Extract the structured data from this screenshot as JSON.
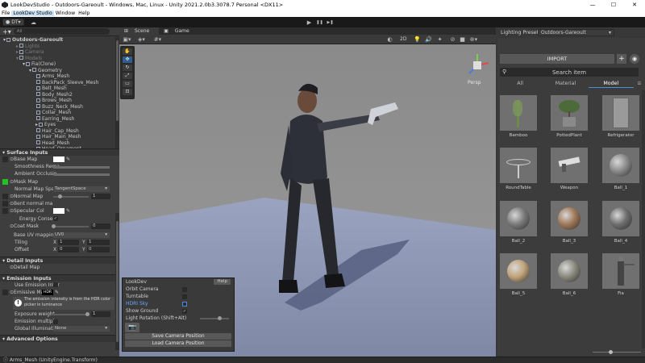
{
  "window": {
    "title": "LookDevStudio - Outdoors-Gareoult - Windows, Mac, Linux - Unity 2021.2.0b3.3078.7 Personal <DX11>",
    "min": "—",
    "max": "☐",
    "close": "✕"
  },
  "menu": [
    "File",
    "LookDev Studio",
    "Window",
    "Help"
  ],
  "toolbar": {
    "account": "DT",
    "play": "▶",
    "pause": "❚❚",
    "step": "▶❚"
  },
  "hierarchy": {
    "search_placeholder": "All",
    "items": [
      {
        "label": "Outdoors-Gareoult",
        "indent": 0,
        "bold": true
      },
      {
        "label": "Lights",
        "indent": 2,
        "dim": true
      },
      {
        "label": "Camera",
        "indent": 2,
        "dim": true
      },
      {
        "label": "Models",
        "indent": 2,
        "dim": true
      },
      {
        "label": "Fia(Clone)",
        "indent": 3
      },
      {
        "label": "Geometry",
        "indent": 4
      },
      {
        "label": "Arms_Mesh",
        "indent": 5
      },
      {
        "label": "BackPack_Sleeve_Mesh",
        "indent": 5
      },
      {
        "label": "Belt_Mesh",
        "indent": 5
      },
      {
        "label": "Body_Mesh2",
        "indent": 5
      },
      {
        "label": "Brows_Mesh",
        "indent": 5
      },
      {
        "label": "Buzz_Neck_Mesh",
        "indent": 5
      },
      {
        "label": "Collar_Mesh",
        "indent": 5
      },
      {
        "label": "Earring_Mesh",
        "indent": 5
      },
      {
        "label": "Eyes",
        "indent": 5
      },
      {
        "label": "Hair_Cap_Mesh",
        "indent": 5
      },
      {
        "label": "Hair_Main_Mesh",
        "indent": 5
      },
      {
        "label": "Head_Mesh",
        "indent": 5
      },
      {
        "label": "Head_Ornament",
        "indent": 5
      }
    ]
  },
  "inspector": {
    "surface_inputs": "Surface Inputs",
    "base_map": "Base Map",
    "smoothness": "Smoothness Rema",
    "ambient_occlusion": "Ambient Occlusio",
    "mask_map": "Mask Map",
    "normal_map_space": "Normal Map Spac",
    "normal_map_space_value": "TangentSpace",
    "normal_map": "Normal Map",
    "normal_map_value": "1",
    "bent_normal": "Bent normal ma",
    "specular": "Specular Col",
    "energy": "Energy Conserv",
    "coat_mask": "Coat Mask",
    "coat_mask_value": "0",
    "base_uv_mapping": "Base UV mapping",
    "base_uv_value": "UV0",
    "tiling": "Tiling",
    "offset": "Offset",
    "tiling_x": "1",
    "tiling_y": "1",
    "offset_x": "0",
    "offset_y": "0",
    "x_label": "X",
    "y_label": "Y",
    "detail_inputs": "Detail Inputs",
    "detail_map": "Detail Map",
    "emission_inputs": "Emission Inputs",
    "use_emission": "Use Emission Inter",
    "emissive_map": "Emissive Ma",
    "hdr_badge": "HDR",
    "help_text": "The emission intensity is from the HDR color picker in luminance",
    "exposure_weight": "Exposure weight",
    "exposure_value": "1",
    "emission_multiply": "Emission multiply",
    "global_illumination": "Global Illumination",
    "gi_value": "None",
    "advanced_options": "Advanced Options"
  },
  "scene": {
    "tabs": [
      "Scene",
      "Game"
    ],
    "mode_2d": "2D",
    "persp": "Persp",
    "gizmo_y": "y",
    "gizmo_x": "x",
    "gizmo_z": "z"
  },
  "lookdev": {
    "title": "LookDev",
    "help": "Help",
    "options": [
      {
        "label": "Orbit Camera",
        "checked": false
      },
      {
        "label": "Turntable",
        "checked": false
      },
      {
        "label": "HDRI Sky",
        "checked": false,
        "highlight": true
      },
      {
        "label": "Show Ground",
        "checked": true
      }
    ],
    "light_rotation": "Light Rotation (Shift+Alt)",
    "save_camera": "Save Camera Position",
    "load_camera": "Load Camera Position"
  },
  "right_panel": {
    "lighting_preset_label": "Lighting Preset:",
    "lighting_preset_value": "Outdoors-Gareoult",
    "import": "IMPORT",
    "search_placeholder": "Search item",
    "tabs": [
      "All",
      "Material",
      "Model"
    ],
    "active_tab": "Model",
    "assets": [
      {
        "label": "Bamboo"
      },
      {
        "label": "PottedPlant"
      },
      {
        "label": "Refrigerator"
      },
      {
        "label": "RoundTable"
      },
      {
        "label": "Weapon"
      },
      {
        "label": "Ball_1"
      },
      {
        "label": "Ball_2"
      },
      {
        "label": "Ball_3"
      },
      {
        "label": "Ball_4"
      },
      {
        "label": "Ball_5"
      },
      {
        "label": "Ball_6"
      },
      {
        "label": "Fia"
      }
    ]
  },
  "status_bar": {
    "text": "Arms_Mesh (UnityEngine.Transform)"
  },
  "colors": {
    "accent": "#4a8fd6",
    "mask_swatch": "#22c022",
    "sky_top": "#8d8d8d",
    "ground": "#8e98b6"
  }
}
